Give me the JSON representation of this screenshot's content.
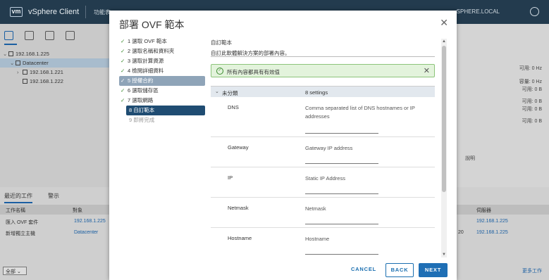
{
  "app": {
    "logo": "vm",
    "title": "vSphere Client",
    "menu": "功能表",
    "user": "SPHERE.LOCAL"
  },
  "nav": {
    "tree": [
      {
        "label": "192.168.1.225",
        "indent": 0,
        "caret": "⌄",
        "selected": false
      },
      {
        "label": "Datacenter",
        "indent": 1,
        "caret": "⌄",
        "selected": true
      },
      {
        "label": "192.168.1.221",
        "indent": 2,
        "caret": "›",
        "selected": false
      },
      {
        "label": "192.168.1.222",
        "indent": 2,
        "caret": "",
        "selected": false
      }
    ]
  },
  "background_stats": {
    "cpu_free": "可用: 0 Hz",
    "used1": "容量: 0 Hz",
    "cap1": "可用: 0 B",
    "used2": "可用: 0 B",
    "cap2": "可用: 0 B",
    "cap3": "可用: 0 B",
    "desc": "說明"
  },
  "tasks": {
    "tab_recent": "最近的工作",
    "tab_alarms": "警示",
    "headers": {
      "name": "工作名稱",
      "target": "對象",
      "server": "伺服器"
    },
    "rows": [
      {
        "name": "匯入 OVF 套件",
        "target": "192.168.1.225",
        "server": "192.168.1.225",
        "mid": ""
      },
      {
        "name": "新增獨立主機",
        "target": "Datacenter",
        "server": "192.168.1.225",
        "mid": "20"
      }
    ],
    "filter": "全部",
    "more": "更多工作"
  },
  "modal": {
    "title": "部署 OVF 範本",
    "close": "✕",
    "steps": [
      {
        "label": "1 選取 OVF 範本",
        "state": "done"
      },
      {
        "label": "2 選取名稱和資料夾",
        "state": "done"
      },
      {
        "label": "3 選取計算資源",
        "state": "done"
      },
      {
        "label": "4 檢閱詳細資料",
        "state": "done"
      },
      {
        "label": "5 授權合約",
        "state": "highlight"
      },
      {
        "label": "6 選取儲存區",
        "state": "done"
      },
      {
        "label": "7 選取網路",
        "state": "done"
      },
      {
        "label": "8 自訂範本",
        "state": "current"
      },
      {
        "label": "9 即將完成",
        "state": "todo"
      }
    ],
    "section_title": "自訂範本",
    "section_desc": "自訂此軟體解決方案的部署內容。",
    "alert": "所有內容都具有有效值",
    "group": {
      "caret": "⌄",
      "name": "未分類",
      "count": "8 settings"
    },
    "fields": [
      {
        "name": "DNS",
        "desc": "Comma separated list of DNS hostnames or IP addresses",
        "value": ""
      },
      {
        "name": "Gateway",
        "desc": "Gateway IP address",
        "value": ""
      },
      {
        "name": "IP",
        "desc": "Static IP Address",
        "value": ""
      },
      {
        "name": "Netmask",
        "desc": "Netmask",
        "value": ""
      },
      {
        "name": "Hostname",
        "desc": "Hostname",
        "value": ""
      }
    ],
    "buttons": {
      "cancel": "CANCEL",
      "back": "BACK",
      "next": "NEXT"
    }
  }
}
